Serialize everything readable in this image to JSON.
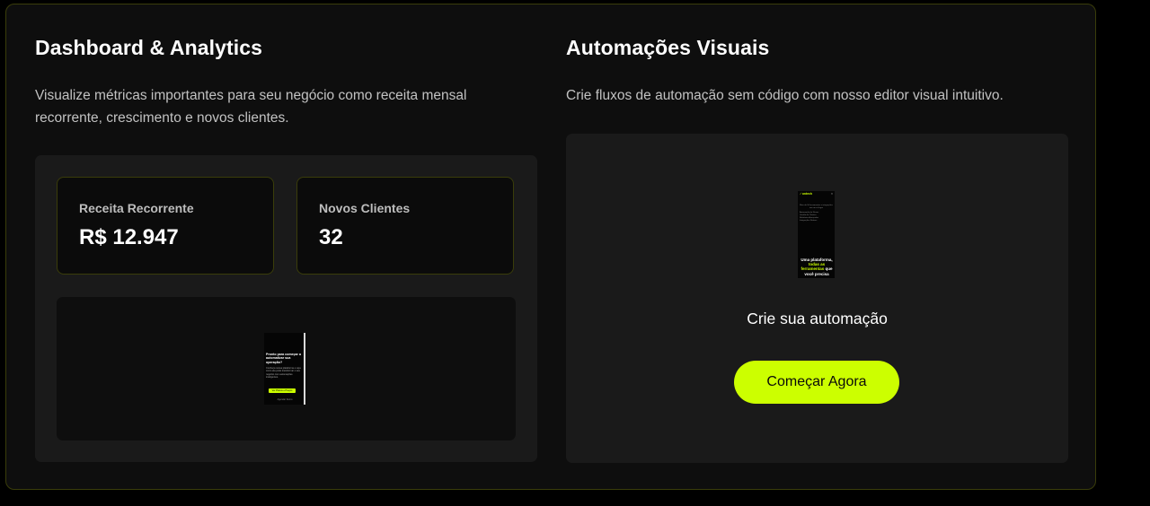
{
  "dashboard": {
    "title": "Dashboard & Analytics",
    "description": "Visualize métricas importantes para seu negócio como receita mensal recorrente, crescimento e novos clientes.",
    "metrics": [
      {
        "label": "Receita Recorrente",
        "value": "R$ 12.947"
      },
      {
        "label": "Novos Clientes",
        "value": "32"
      }
    ],
    "preview": {
      "heading": "Pronto para começar a automatizar sua operação?",
      "body": "Conheça nossa plataforma e veja como ela pode transformar o seu negócio com automações inteligentes.",
      "button": "Ver Planos e Preços",
      "footer": "Agendar Demo"
    }
  },
  "automations": {
    "title": "Automações Visuais",
    "description": "Crie fluxos de automação sem código com nosso editor visual intuitivo.",
    "preview": {
      "logo": "✓ontech",
      "close": "×",
      "subtitle": "Mais de 50 ferramentas e integrações em um só lugar",
      "items": [
        "Automação de Fluxos",
        "Gestão de Clientes",
        "Relatórios Avançados",
        "Integrações Nativas"
      ],
      "headline_a": "Uma plataforma,",
      "headline_highlight": "todas as ferramentas",
      "headline_b": "que você precisa"
    },
    "cta_title": "Crie sua automação",
    "cta_button": "Começar Agora"
  },
  "colors": {
    "accent": "#ccff00",
    "background": "#0e0e0e",
    "panel": "#1a1a1a",
    "border": "#3a3d0a"
  }
}
